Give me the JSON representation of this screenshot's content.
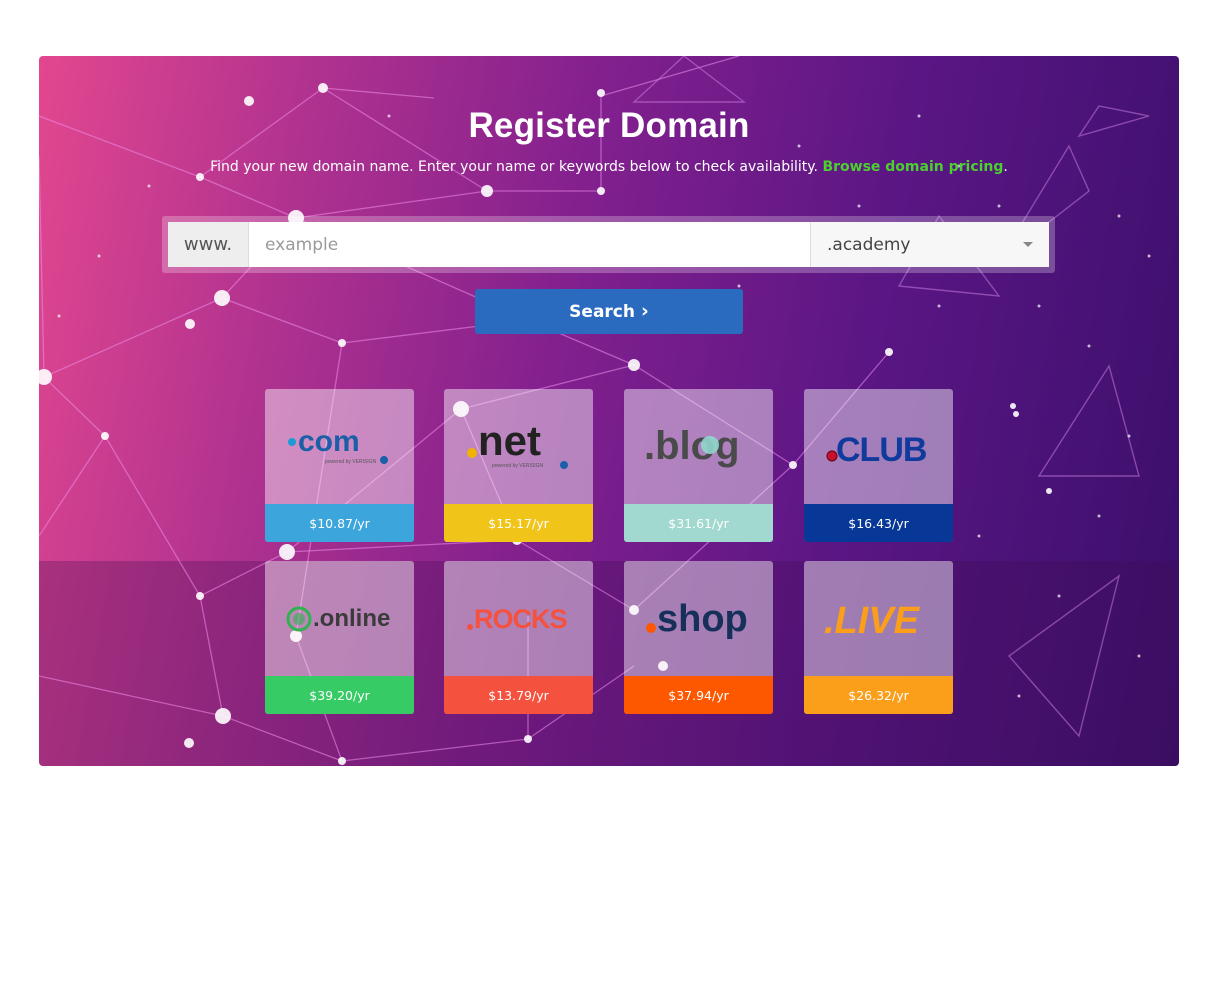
{
  "header": {
    "title": "Register Domain",
    "subtitle": "Find your new domain name. Enter your name or keywords below to check availability.",
    "pricing_link": "Browse domain pricing",
    "pricing_link_suffix": "."
  },
  "search": {
    "prefix": "www.",
    "placeholder": "example",
    "value": "",
    "tld_selected": ".academy",
    "button_label": "Search"
  },
  "tlds": [
    {
      "name": ".com",
      "price": "$10.87/yr",
      "color": "#3ba5dc",
      "logo_text": "com",
      "powered_by": "powered by VERISIGN"
    },
    {
      "name": ".net",
      "price": "$15.17/yr",
      "color": "#f0c419",
      "logo_text": "net",
      "powered_by": "powered by VERISIGN"
    },
    {
      "name": ".blog",
      "price": "$31.61/yr",
      "color": "#a1d8d0",
      "logo_text": ".blog"
    },
    {
      "name": ".club",
      "price": "$16.43/yr",
      "color": "#073797",
      "logo_text": "CLUB"
    },
    {
      "name": ".online",
      "price": "$39.20/yr",
      "color": "#37cb65",
      "logo_text": ".online"
    },
    {
      "name": ".rocks",
      "price": "$13.79/yr",
      "color": "#f5513f",
      "logo_text": "ROCKS"
    },
    {
      "name": ".shop",
      "price": "$37.94/yr",
      "color": "#fd5800",
      "logo_text": "shop"
    },
    {
      "name": ".live",
      "price": "$26.32/yr",
      "color": "#fb9e1a",
      "logo_text": ".LIVE"
    }
  ]
}
